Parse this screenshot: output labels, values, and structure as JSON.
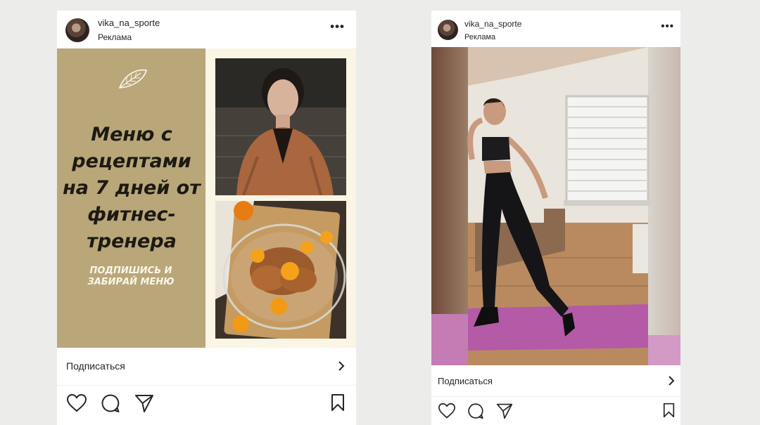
{
  "posts": [
    {
      "username": "vika_na_sporte",
      "sponsored_label": "Реклама",
      "ad": {
        "title": "Меню с рецептами на 7 дней от фитнес-тренера",
        "cta": "ПОДПИШИСЬ И ЗАБИРАЙ МЕНЮ"
      },
      "follow_label": "Подписаться"
    },
    {
      "username": "vika_na_sporte",
      "sponsored_label": "Реклама",
      "follow_label": "Подписаться"
    }
  ],
  "icons": {
    "more": "more-options-icon",
    "heart": "heart-icon",
    "comment": "comment-icon",
    "share": "share-icon",
    "bookmark": "bookmark-icon",
    "chevron": "chevron-right-icon",
    "leaf": "leaf-icon"
  },
  "colors": {
    "page_background": "#ececea",
    "ad_panel": "#b9a77a",
    "ad_title": "#1d1a12",
    "ad_cta": "#fbf6e8",
    "yoga_mat": "#b45aa6"
  }
}
